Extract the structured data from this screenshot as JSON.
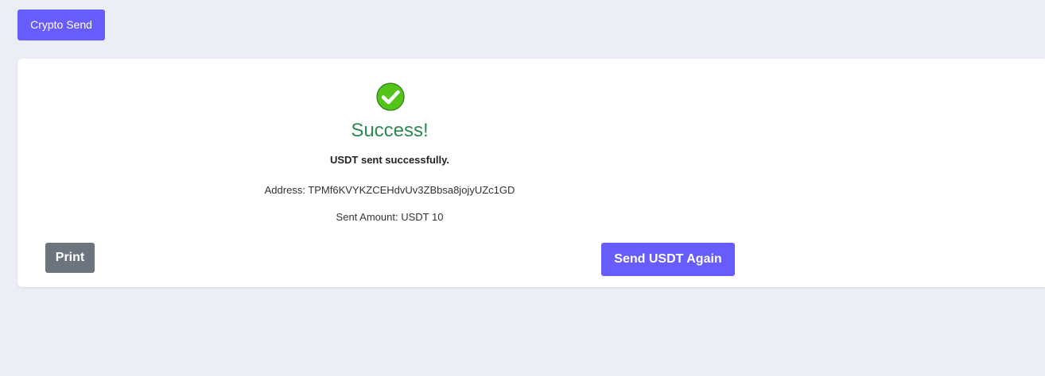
{
  "header": {
    "app_button_label": "Crypto Send"
  },
  "result": {
    "icon": "check-circle-icon",
    "title": "Success!",
    "message": "USDT sent successfully.",
    "address_text": "Address: TPMf6KVYKZCEHdvUv3ZBbsa8jojyUZc1GD",
    "amount_text": "Sent Amount: USDT 10"
  },
  "actions": {
    "print_label": "Print",
    "send_again_label": "Send USDT Again"
  },
  "colors": {
    "accent": "#675cfe",
    "success_green": "#2b8a4f",
    "icon_green": "#52c41a",
    "secondary_gray": "#6c757d",
    "page_background": "#ebeef4"
  }
}
